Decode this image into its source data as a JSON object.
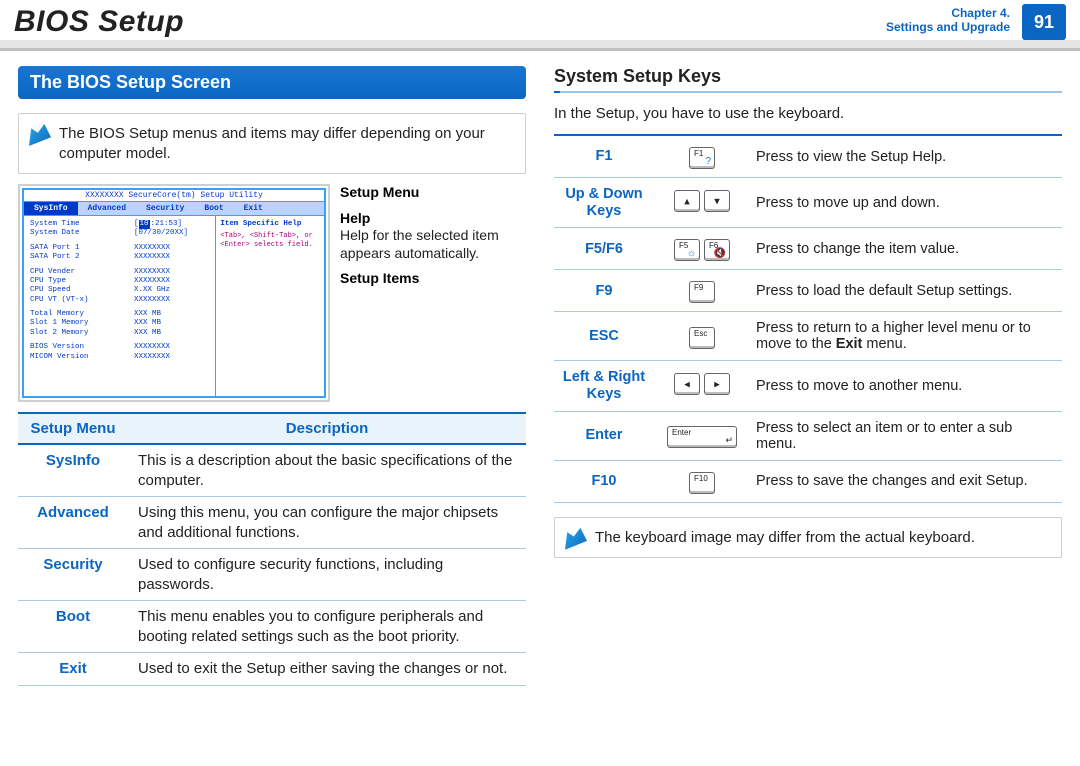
{
  "header": {
    "title": "BIOS Setup",
    "chapter_line1": "Chapter 4.",
    "chapter_line2": "Settings and Upgrade",
    "page_number": "91"
  },
  "left": {
    "section_title": "The BIOS Setup Screen",
    "note": "The BIOS Setup menus and items may differ depending on your computer model.",
    "callouts": {
      "setup_menu": "Setup Menu",
      "help_title": "Help",
      "help_body": "Help for the selected item appears automatically.",
      "setup_items": "Setup Items"
    },
    "bios": {
      "utility_title": "XXXXXXXX SecureCore(tm) Setup Utility",
      "tabs": [
        "SysInfo",
        "Advanced",
        "Security",
        "Boot",
        "Exit"
      ],
      "rows": [
        {
          "k": "System Time",
          "v": "[10:21:53]",
          "highlight_first": true
        },
        {
          "k": "System Date",
          "v": "[07/30/20XX]"
        },
        {
          "sep": true
        },
        {
          "k": "SATA Port 1",
          "v": "XXXXXXXX"
        },
        {
          "k": "SATA Port 2",
          "v": "XXXXXXXX"
        },
        {
          "sep": true
        },
        {
          "k": "CPU Vender",
          "v": "XXXXXXXX"
        },
        {
          "k": "CPU Type",
          "v": "XXXXXXXX"
        },
        {
          "k": "CPU Speed",
          "v": "X.XX GHz"
        },
        {
          "k": "CPU VT (VT-x)",
          "v": "XXXXXXXX"
        },
        {
          "sep": true
        },
        {
          "k": "Total Memory",
          "v": "XXX MB"
        },
        {
          "k": "  Slot 1 Memory",
          "v": "XXX MB"
        },
        {
          "k": "  Slot 2 Memory",
          "v": "XXX MB"
        },
        {
          "sep": true
        },
        {
          "k": "BIOS Version",
          "v": "XXXXXXXX"
        },
        {
          "k": "MICOM Version",
          "v": "XXXXXXXX"
        }
      ],
      "help_header": "Item Specific Help",
      "help_hint": "<Tab>, <Shift-Tab>, or <Enter> selects field."
    },
    "menu_table": {
      "headers": [
        "Setup Menu",
        "Description"
      ],
      "rows": [
        {
          "name": "SysInfo",
          "desc": "This is a description about the basic specifications of the computer."
        },
        {
          "name": "Advanced",
          "desc": "Using this menu, you can configure the major chipsets and additional functions."
        },
        {
          "name": "Security",
          "desc": "Used to configure security functions, including passwords."
        },
        {
          "name": "Boot",
          "desc": "This menu enables you to configure peripherals and booting related settings such as the boot priority."
        },
        {
          "name": "Exit",
          "desc": "Used to exit the Setup either saving the changes or not."
        }
      ]
    }
  },
  "right": {
    "section_title": "System Setup Keys",
    "intro": "In the Setup, you have to use the keyboard.",
    "keys": [
      {
        "name": "F1",
        "caps": [
          {
            "label": "F1",
            "icon": "?"
          }
        ],
        "desc": "Press to view the Setup Help."
      },
      {
        "name": "Up & Down Keys",
        "caps": [
          {
            "arrow": "▴"
          },
          {
            "arrow": "▾"
          }
        ],
        "desc": "Press to move up and down."
      },
      {
        "name": "F5/F6",
        "caps": [
          {
            "label": "F5",
            "icon": "☼"
          },
          {
            "label": "F6",
            "icon": "🔇"
          }
        ],
        "desc": "Press to change the item value."
      },
      {
        "name": "F9",
        "caps": [
          {
            "label": "F9"
          }
        ],
        "desc": "Press to load the default Setup settings."
      },
      {
        "name": "ESC",
        "caps": [
          {
            "label": "Esc"
          }
        ],
        "desc_html": "Press to return to a higher level menu or to move to the <b>Exit</b> menu."
      },
      {
        "name": "Left & Right Keys",
        "caps": [
          {
            "arrow": "◂"
          },
          {
            "arrow": "▸"
          }
        ],
        "desc": "Press to move to another menu."
      },
      {
        "name": "Enter",
        "caps": [
          {
            "label": "Enter",
            "wide": true,
            "sub": "↵"
          }
        ],
        "desc": "Press to select an item or to enter a sub menu."
      },
      {
        "name": "F10",
        "caps": [
          {
            "label": "F10"
          }
        ],
        "desc": "Press to save the changes and exit Setup."
      }
    ],
    "note": "The keyboard image may differ from the actual keyboard."
  }
}
